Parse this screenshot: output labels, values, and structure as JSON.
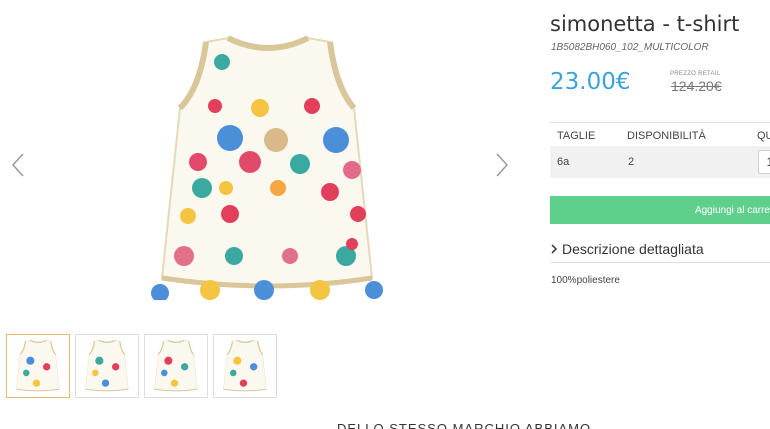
{
  "product": {
    "title": "simonetta - t-shirt",
    "sku": "1B5082BH060_102_MULTICOLOR",
    "price": "23.00€",
    "retail_label": "PREZZO RETAIL",
    "retail_price": "124.20€"
  },
  "availability": {
    "headers": [
      "TAGLIE",
      "DISPONIBILITÀ",
      "QU"
    ],
    "rows": [
      {
        "size": "6a",
        "quantity": "2",
        "qty_value": "1"
      }
    ]
  },
  "add_to_cart_label": "Aggiungi al carre",
  "description": {
    "label": "Descrizione dettagliata",
    "content": "100%poliestere"
  },
  "gallery": {
    "thumbnails": 4,
    "active_index": 0
  },
  "footer": {
    "heading": "DELLO STESSO MARCHIO ABBIAMO"
  },
  "colors": {
    "price": "#3aa3d8",
    "button": "#5fcf8c",
    "active_thumb_border": "#e8b96a"
  },
  "icons": [
    "chevron-left-icon",
    "chevron-right-icon",
    "chevron-right-small-icon"
  ]
}
